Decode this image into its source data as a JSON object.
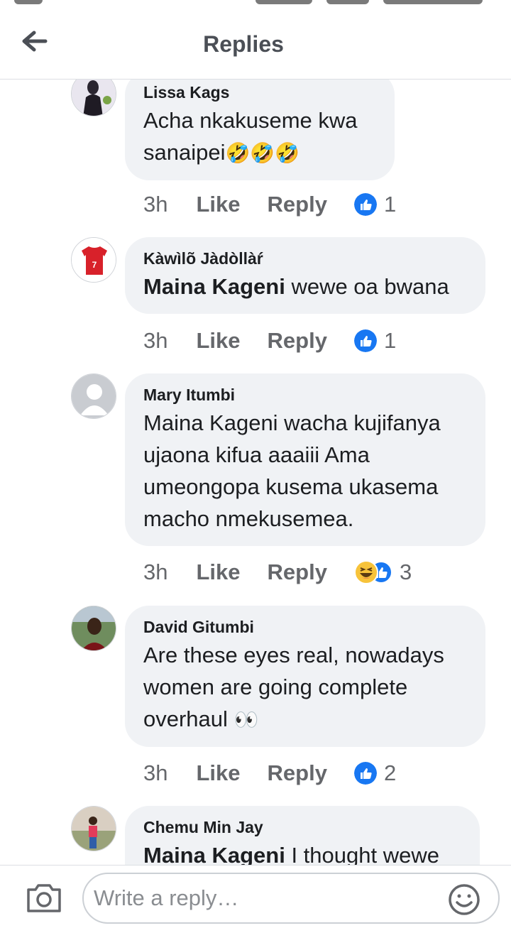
{
  "header": {
    "title": "Replies"
  },
  "comments": [
    {
      "author": "Lissa Kags",
      "text": "Acha nkakuseme kwa sanaipei",
      "emoji": "🤣🤣🤣",
      "time": "3h",
      "like_label": "Like",
      "reply_label": "Reply",
      "reaction": "like",
      "count": "1"
    },
    {
      "author": "Kàwìlõ Jàdòllàŕ",
      "mention": "Maina Kageni",
      "text": " wewe oa bwana",
      "time": "3h",
      "like_label": "Like",
      "reply_label": "Reply",
      "reaction": "like",
      "count": "1"
    },
    {
      "author": "Mary Itumbi",
      "line1": "Maina Kageni wacha kujifanya",
      "line2": "ujaona kifua aaaiii Ama",
      "line3": "umeongopa kusema ukasema",
      "line4": "macho nmekusemea.",
      "time": "3h",
      "like_label": "Like",
      "reply_label": "Reply",
      "reaction": "haha+like",
      "count": "3"
    },
    {
      "author": "David Gitumbi",
      "line1": "Are these eyes real, nowadays",
      "line2": "women are going complete",
      "line3": "overhaul",
      "emoji": "👀",
      "time": "3h",
      "like_label": "Like",
      "reply_label": "Reply",
      "reaction": "like",
      "count": "2"
    },
    {
      "author": "Chemu Min Jay",
      "mention": "Maina Kageni",
      "text": " I thought wewe"
    }
  ],
  "composer": {
    "placeholder": "Write a reply…"
  },
  "colors": {
    "accent": "#1877f2",
    "bubble": "#f0f2f5",
    "muted": "#65676b"
  }
}
